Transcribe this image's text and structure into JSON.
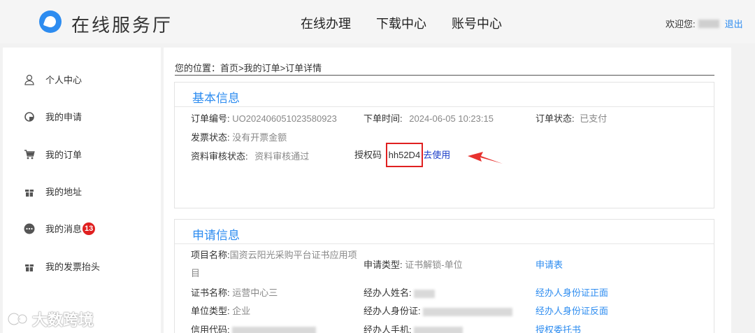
{
  "header": {
    "logo_text": "在线服务厅",
    "nav": [
      "在线办理",
      "下载中心",
      "账号中心"
    ],
    "welcome_label": "欢迎您:",
    "logout_label": "退出"
  },
  "sidebar": {
    "items": [
      {
        "label": "个人中心",
        "icon": "user-icon"
      },
      {
        "label": "我的申请",
        "icon": "apply-icon"
      },
      {
        "label": "我的订单",
        "icon": "cart-icon"
      },
      {
        "label": "我的地址",
        "icon": "gift-icon"
      },
      {
        "label": "我的消息",
        "icon": "message-icon",
        "badge": "13"
      },
      {
        "label": "我的发票抬头",
        "icon": "gift-icon"
      }
    ]
  },
  "breadcrumb": "您的位置：首页>我的订单>订单详情",
  "basic_info": {
    "title": "基本信息",
    "order_no_label": "订单编号:",
    "order_no": "UO202406051023580923",
    "order_time_label": "下单时间:",
    "order_time": "2024-06-05 10:23:15",
    "order_status_label": "订单状态:",
    "order_status": "已支付",
    "invoice_status_label": "发票状态:",
    "invoice_status": "没有开票金额",
    "review_status_label": "资料审核状态:",
    "review_status": "资料审核通过",
    "auth_code_label": "授权码",
    "auth_code": "hh52D4",
    "use_link": "去使用"
  },
  "apply_info": {
    "title": "申请信息",
    "project_label": "项目名称:",
    "project_line1": "国资云阳光采购平台证书应用项",
    "project_line2": "目",
    "apply_type_label": "申请类型:",
    "apply_type": "证书解锁-单位",
    "apply_form_link": "申请表",
    "cert_name_label": "证书名称:",
    "cert_name": "运营中心三",
    "agent_name_label": "经办人姓名:",
    "id_front_link": "经办人身份证正面",
    "unit_type_label": "单位类型:",
    "unit_type": "企业",
    "agent_id_label": "经办人身份证:",
    "id_back_link": "经办人身份证反面",
    "credit_code_label": "信用代码:",
    "agent_phone_label": "经办人手机:",
    "authorization_link": "授权委托书"
  },
  "watermark": "大数跨境",
  "colors": {
    "accent": "#2d8cf0",
    "badge": "#e02020",
    "highlight": "#e02020"
  }
}
